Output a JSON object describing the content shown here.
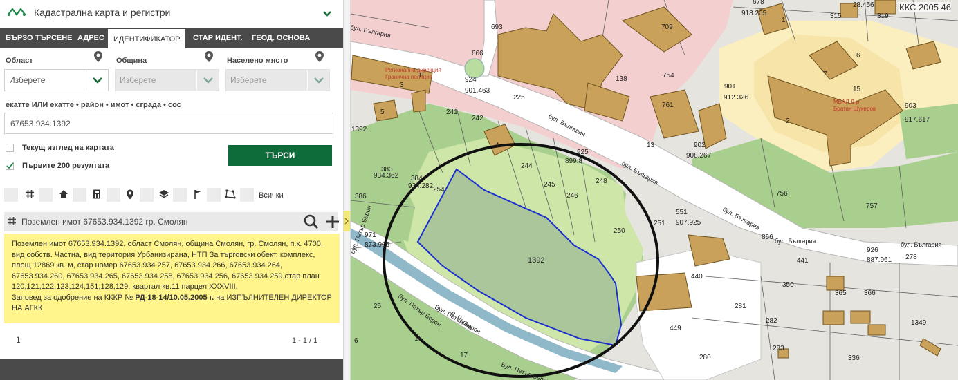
{
  "app": {
    "title": "Кадастрална карта и регистри",
    "crs": "ККС 2005 46"
  },
  "tabs": [
    {
      "label": "БЪРЗО ТЪРСЕНЕ"
    },
    {
      "label": "АДРЕС"
    },
    {
      "label": "ИДЕНТИФИКАТОР",
      "active": true
    },
    {
      "label": "СТАР ИДЕНТ."
    },
    {
      "label": "ГЕОД. ОСНОВА"
    }
  ],
  "filters": {
    "oblast": {
      "label": "Област",
      "value": "Изберете"
    },
    "obshtina": {
      "label": "Община",
      "value": "Изберете"
    },
    "naseleno": {
      "label": "Населено място",
      "value": "Изберете"
    }
  },
  "ekatte": {
    "label": "екатте ИЛИ екатте • район • имот • сграда • сос",
    "value": "67653.934.1392"
  },
  "options": {
    "current_view": "Текущ изглед на картата",
    "first_200": "Първите 200 резултата",
    "current_view_checked": false,
    "first_200_checked": true
  },
  "search_button": "ТЪРСИ",
  "type_filter": {
    "all_label": "Всички",
    "icons": [
      "grid-icon",
      "home-icon",
      "calculator-icon",
      "map-pin-icon",
      "layers-icon",
      "flag-icon",
      "polygon-icon"
    ]
  },
  "result": {
    "title": "Поземлен имот 67653.934.1392 гр. Смолян",
    "text": "Поземлен имот 67653.934.1392, област Смолян, община Смолян, гр. Смолян, п.к. 4700, вид собств. Частна, вид територия Урбанизирана, НТП За търговски обект, комплекс, площ 12869 кв. м, стар номер 67653.934.257, 67653.934.266, 67653.934.264, 67653.934.260, 67653.934.265, 67653.934.258, 67653.934.256, 67653.934.259,стар план 120,121,122,123,124,151,128,129, квартал кв.11 парцел XXXVIII,",
    "order_prefix": "Заповед за одобрение на КККР № ",
    "order_number": "РД-18-14/10.05.2005 г.",
    "order_suffix": " на ИЗПЪЛНИТЕЛЕН ДИРЕКТОР НА АГКК"
  },
  "pagination": {
    "page": "1",
    "range": "1 - 1 / 1"
  },
  "map": {
    "colors": {
      "parcel_fill": "#a6bf9a",
      "parcel_border": "#1a2fd0",
      "building": "#c9a15a",
      "urban_zone": "#f4cfd0",
      "green": "#a9cf8f",
      "light_green": "#cfe6a9",
      "road": "#ffffff",
      "circle": "#111111"
    },
    "street_labels": [
      "бул. България",
      "бул. България",
      "бул. България",
      "бул. България",
      "бул. България",
      "бул. България",
      "бул. Петър Берон",
      "бул. Петър Берон",
      "Бул. Петър Берон",
      "р. Черна",
      "Бул. Петър Берон"
    ],
    "parcel_numbers": [
      "693",
      "866",
      "924",
      "901.463",
      "225",
      "754",
      "761",
      "901",
      "912.326",
      "903",
      "917.617",
      "241",
      "242",
      "1392",
      "383",
      "934.362",
      "384",
      "934.282",
      "254",
      "386",
      "244",
      "245",
      "246",
      "248",
      "925",
      "899.8",
      "902",
      "908.267",
      "551",
      "907.925",
      "251",
      "250",
      "756",
      "757",
      "866",
      "926",
      "887.961",
      "278",
      "441",
      "350",
      "365",
      "366",
      "971",
      "873.905",
      "1392",
      "440",
      "281",
      "282",
      "1349",
      "449",
      "283",
      "336",
      "280",
      "25",
      "16",
      "17",
      "6",
      "678",
      "918.205",
      "315",
      "319",
      "28.456",
      "138",
      "709",
      "1",
      "2",
      "3",
      "5",
      "6",
      "7",
      "13",
      "15",
      "Р",
      "4"
    ],
    "poi_labels": [
      "МБАЛ Д-р Братан Шукеров",
      "Регионална дирекция Гранична полиция"
    ]
  }
}
